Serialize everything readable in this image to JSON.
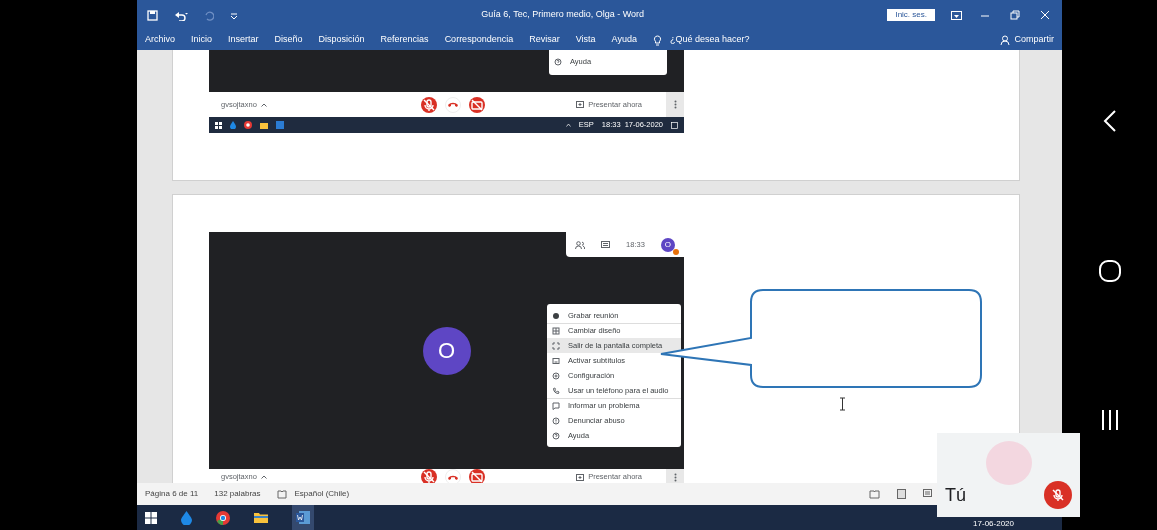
{
  "word": {
    "title": "Guía 6, Tec, Primero medio, Olga  -  Word",
    "sign_in": "Inic. ses.",
    "ribbon_tabs": [
      "Archivo",
      "Inicio",
      "Insertar",
      "Diseño",
      "Disposición",
      "Referencias",
      "Correspondencia",
      "Revisar",
      "Vista",
      "Ayuda"
    ],
    "tell_me": "¿Qué desea hacer?",
    "share": "Compartir"
  },
  "document": {
    "snapshot_1": {
      "menu_items": [
        {
          "kind": "help",
          "label": "Ayuda"
        }
      ],
      "participant": "gvsojtaxno",
      "mic_muted": true,
      "camera_off": true,
      "present": "Presentar ahora",
      "taskbar": {
        "language": "ESP",
        "time": "18:33",
        "date": "17-06-2020"
      }
    },
    "snapshot_2": {
      "time": "18:33",
      "small_avatar_letter": "O",
      "avatar_letter": "O",
      "menu_items": [
        {
          "kind": "record",
          "label": "Grabar reunión",
          "selected": false,
          "divider_before": false
        },
        {
          "kind": "layout",
          "label": "Cambiar diseño",
          "selected": false,
          "divider_before": true
        },
        {
          "kind": "fullscreen",
          "label": "Salir de la pantalla completa",
          "selected": true,
          "divider_before": false
        },
        {
          "kind": "captions",
          "label": "Activar subtítulos",
          "selected": false,
          "divider_before": false
        },
        {
          "kind": "settings",
          "label": "Configuración",
          "selected": false,
          "divider_before": false
        },
        {
          "kind": "phone",
          "label": "Usar un teléfono para el audio",
          "selected": false,
          "divider_before": false
        },
        {
          "kind": "report",
          "label": "Informar un problema",
          "selected": false,
          "divider_before": true
        },
        {
          "kind": "abuse",
          "label": "Denunciar abuso",
          "selected": false,
          "divider_before": false
        },
        {
          "kind": "help",
          "label": "Ayuda",
          "selected": false,
          "divider_before": false
        }
      ],
      "participant": "gvsojtaxno",
      "mic_muted": true,
      "camera_off": true,
      "present": "Presentar ahora"
    }
  },
  "status_bar": {
    "page": "Página 6 de 11",
    "words": "132 palabras",
    "language": "Español (Chile)"
  },
  "taskbar": {
    "date": "17-06-2020"
  },
  "call_tile": {
    "name": "Tú",
    "mic_muted": true
  }
}
